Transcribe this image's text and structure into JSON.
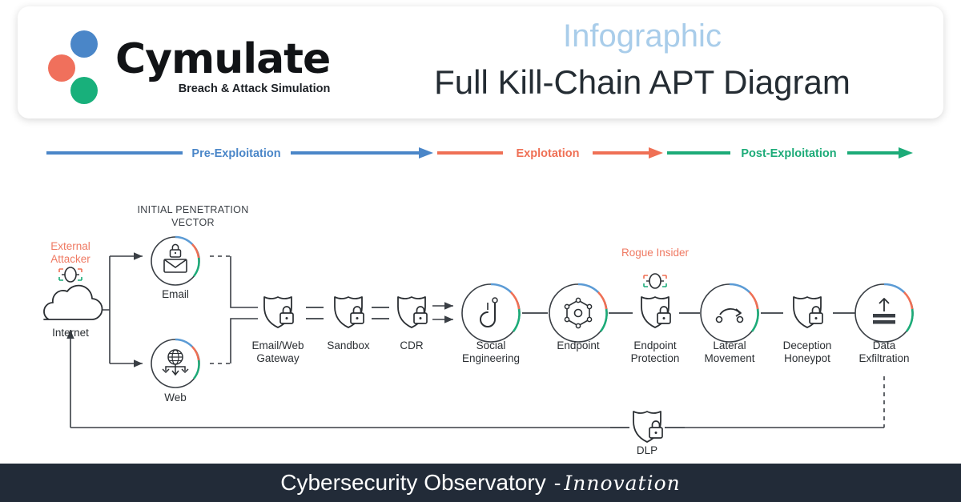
{
  "header": {
    "logo": {
      "name": "Cymulate",
      "tagline": "Breach & Attack Simulation",
      "dot_blue": "#4a86c8",
      "dot_red": "#f0705c",
      "dot_green": "#18b07b"
    },
    "kicker": "Infographic",
    "title": "Full Kill-Chain APT Diagram"
  },
  "phases": [
    {
      "label": "Pre-Exploitation",
      "color": "#4a86c8"
    },
    {
      "label": "Explotation",
      "color": "#ef7055"
    },
    {
      "label": "Post-Exploitation",
      "color": "#1cab78"
    }
  ],
  "diagram": {
    "section_label": "INITIAL PENETRATION\nVECTOR",
    "section_label_line1": "INITIAL PENETRATION",
    "section_label_line2": "VECTOR",
    "attacker": {
      "label_line1": "External",
      "label_line2": "Attacker",
      "color": "#ef7a63",
      "icon": "bug-icon"
    },
    "insider": {
      "label": "Rogue Insider",
      "color": "#ef7a63",
      "icon": "bug-icon"
    },
    "nodes": [
      {
        "id": "internet",
        "label_line1": "Internet",
        "label_line2": "",
        "icon": "cloud-icon",
        "shape": "plain"
      },
      {
        "id": "email",
        "label_line1": "Email",
        "label_line2": "",
        "icon": "envelope-lock-icon",
        "shape": "circle"
      },
      {
        "id": "web",
        "label_line1": "Web",
        "label_line2": "",
        "icon": "globe-arrows-icon",
        "shape": "circle"
      },
      {
        "id": "email-web-gateway",
        "label_line1": "Email/Web",
        "label_line2": "Gateway",
        "icon": "shield-lock-icon",
        "shape": "shield"
      },
      {
        "id": "sandbox",
        "label_line1": "Sandbox",
        "label_line2": "",
        "icon": "shield-lock-icon",
        "shape": "shield"
      },
      {
        "id": "cdr",
        "label_line1": "CDR",
        "label_line2": "",
        "icon": "shield-lock-icon",
        "shape": "shield"
      },
      {
        "id": "social-engineering",
        "label_line1": "Social",
        "label_line2": "Engineering",
        "icon": "fish-hook-icon",
        "shape": "circle"
      },
      {
        "id": "endpoint",
        "label_line1": "Endpoint",
        "label_line2": "",
        "icon": "hexagon-node-icon",
        "shape": "circle"
      },
      {
        "id": "endpoint-protection",
        "label_line1": "Endpoint",
        "label_line2": "Protection",
        "icon": "shield-lock-icon",
        "shape": "shield"
      },
      {
        "id": "lateral-movement",
        "label_line1": "Lateral",
        "label_line2": "Movement",
        "icon": "arc-arrow-icon",
        "shape": "circle"
      },
      {
        "id": "deception-honeypot",
        "label_line1": "Deception",
        "label_line2": "Honeypot",
        "icon": "shield-lock-icon",
        "shape": "shield"
      },
      {
        "id": "data-exfiltration",
        "label_line1": "Data",
        "label_line2": "Exfiltration",
        "icon": "upload-bars-icon",
        "shape": "circle"
      },
      {
        "id": "dlp",
        "label_line1": "DLP",
        "label_line2": "",
        "icon": "shield-lock-icon",
        "shape": "shield"
      }
    ],
    "ring_colors": {
      "blue": "#5b9bd5",
      "red": "#ef7055",
      "green": "#1cab78"
    },
    "line_color": "#3a3f45"
  },
  "footer": {
    "main": "Cybersecurity Observatory",
    "separator": "-",
    "alt": "Innovation",
    "background": "#222b38"
  }
}
